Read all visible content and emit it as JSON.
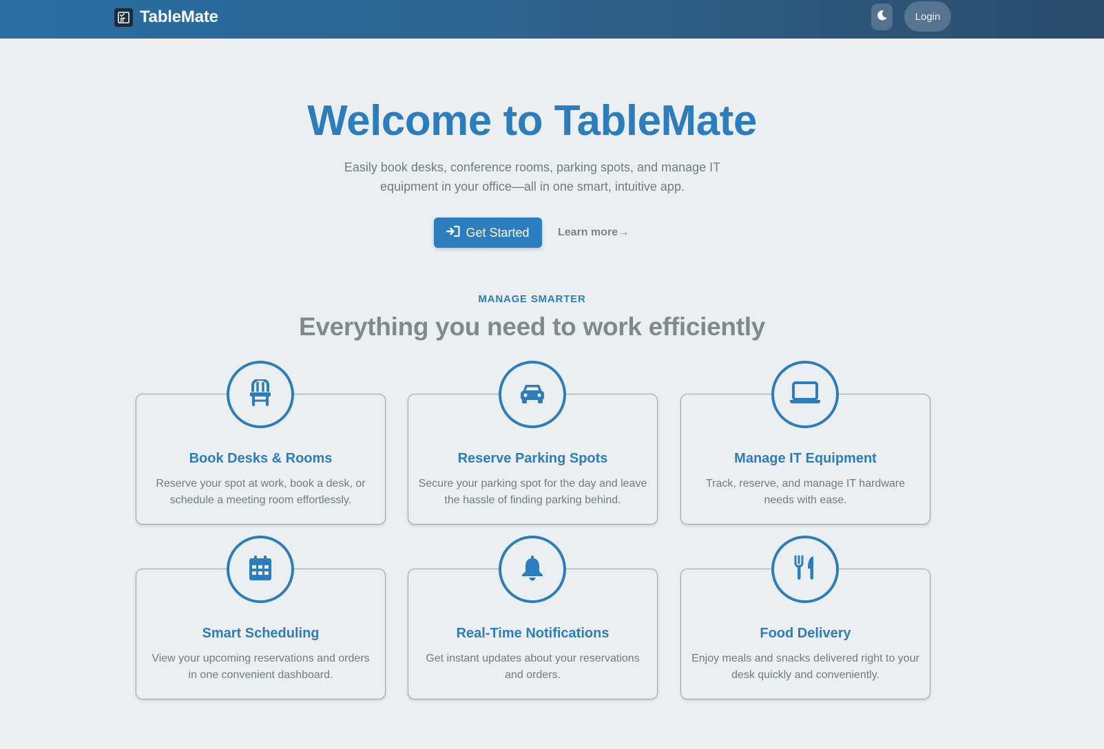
{
  "header": {
    "brand_icon": "checklist-icon",
    "brand_name": "TableMate",
    "theme_toggle_icon": "moon-icon",
    "login_label": "Login"
  },
  "hero": {
    "title": "Welcome to TableMate",
    "subtitle": "Easily book desks, conference rooms, parking spots, and manage IT equipment in your office—all in one smart, intuitive app.",
    "primary_cta": {
      "label": "Get Started",
      "icon": "sign-in-icon"
    },
    "secondary_cta": {
      "label": "Learn more→"
    }
  },
  "features": {
    "eyebrow": "MANAGE SMARTER",
    "title": "Everything you need to work efficiently",
    "cards": [
      {
        "icon": "chair-icon",
        "title": "Book Desks & Rooms",
        "description": "Reserve your spot at work, book a desk, or schedule a meeting room effortlessly."
      },
      {
        "icon": "car-icon",
        "title": "Reserve Parking Spots",
        "description": "Secure your parking spot for the day and leave the hassle of finding parking behind."
      },
      {
        "icon": "laptop-icon",
        "title": "Manage IT Equipment",
        "description": "Track, reserve, and manage IT hardware needs with ease."
      },
      {
        "icon": "calendar-icon",
        "title": "Smart Scheduling",
        "description": "View your upcoming reservations and orders in one convenient dashboard."
      },
      {
        "icon": "bell-icon",
        "title": "Real-Time Notifications",
        "description": "Get instant updates about your reservations and orders."
      },
      {
        "icon": "utensils-icon",
        "title": "Food Delivery",
        "description": "Enjoy meals and snacks delivered right to your desk quickly and conveniently."
      }
    ]
  },
  "colors": {
    "accent": "#2b7dbd",
    "header_start": "#2a6fa4",
    "header_end": "#2c4b6a",
    "background": "#eceff1",
    "muted_text": "#707c7f"
  }
}
